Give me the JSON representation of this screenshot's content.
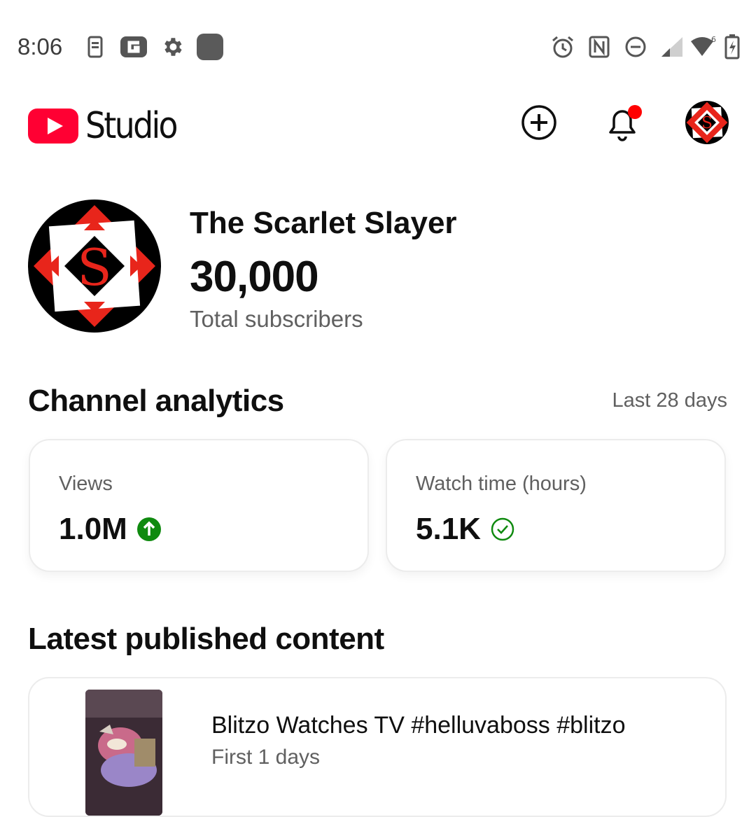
{
  "status_bar": {
    "time": "8:06",
    "icons": [
      "phone-icon",
      "g-app-icon",
      "settings-icon",
      "app-square-icon",
      "alarm-icon",
      "nfc-icon",
      "do-not-disturb-icon",
      "signal-icon",
      "wifi-icon",
      "battery-icon"
    ],
    "wifi_badge": "6"
  },
  "header": {
    "app_name": "Studio",
    "brand_color": "#ff0000",
    "notification_dot_color": "#ff0000",
    "actions": [
      "create-icon",
      "notifications-icon",
      "account-avatar"
    ]
  },
  "channel": {
    "name": "The Scarlet Slayer",
    "subscriber_count": "30,000",
    "subscriber_label": "Total subscribers",
    "avatar_letter": "S"
  },
  "analytics": {
    "title": "Channel analytics",
    "period": "Last 28 days",
    "cards": [
      {
        "label": "Views",
        "value": "1.0M",
        "indicator": "up-arrow-icon",
        "indicator_color": "#0f8a0f"
      },
      {
        "label": "Watch time (hours)",
        "value": "5.1K",
        "indicator": "check-circle-icon",
        "indicator_color": "#0f8a0f"
      }
    ]
  },
  "latest": {
    "title": "Latest published content",
    "video": {
      "title": "Blitzo Watches TV #helluvaboss #blitzo",
      "subtitle": "First 1 days"
    }
  }
}
